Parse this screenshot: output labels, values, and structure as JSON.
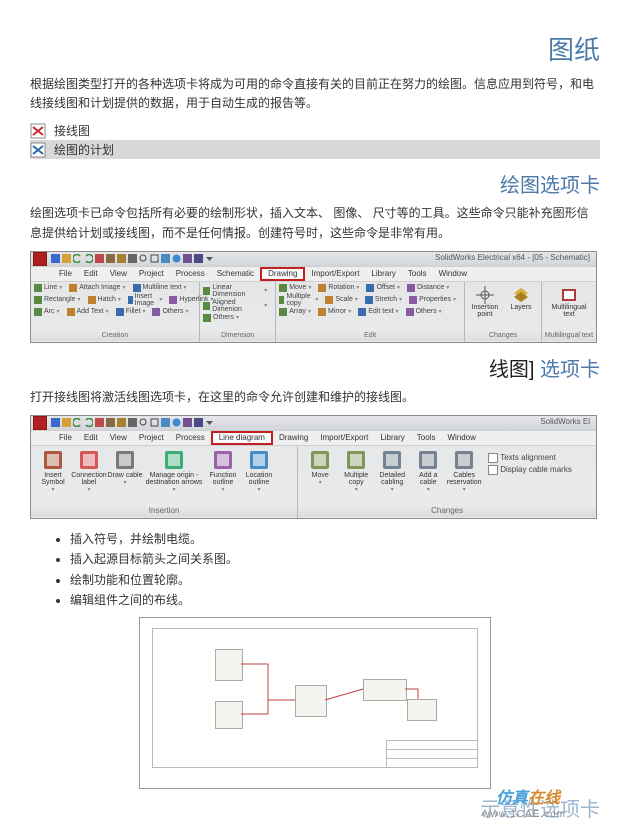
{
  "title_main": "图纸",
  "intro_text": "根据绘图类型打开的各种选项卡将成为可用的命令直接有关的目前正在努力的绘图。信息应用到符号，和电线接线图和计划提供的数据，用于自动生成的报告等。",
  "link_items": [
    {
      "label": "接线图",
      "icon_color": "#c03030"
    },
    {
      "label": "绘图的计划",
      "icon_color": "#2a6aa8",
      "selected": true
    }
  ],
  "section1_title": "绘图选项卡",
  "section1_text": "绘图选项卡已命令包括所有必要的绘制形状，插入文本、 图像、 尺寸等的工具。这些命令只能补充图形信息提供给计划或接线图，而不是任何情报。创建符号时，这些命令是非常有用。",
  "ribbon1": {
    "window_title": "SolidWorks Electrical x64 - [05 - Schematic]",
    "tabs": [
      "File",
      "Edit",
      "View",
      "Project",
      "Process",
      "Schematic",
      "Drawing",
      "Import/Export",
      "Library",
      "Tools",
      "Window"
    ],
    "active_tab": "Drawing",
    "group_creation": {
      "name": "Creation",
      "row1": [
        "Line",
        "Attach Image",
        "Multiline text"
      ],
      "row2": [
        "Rectangle",
        "Hatch",
        "Insert Image",
        "Hyperlink"
      ],
      "row3": [
        "Arc",
        "Add Text",
        "Fillet",
        "Others"
      ]
    },
    "group_dimension": {
      "name": "Dimension",
      "row1": [
        "Linear Dimension"
      ],
      "row2": [
        "Aligned Dimenion"
      ],
      "row3": [
        "Others"
      ]
    },
    "group_edit": {
      "name": "Edit",
      "row1": [
        "Move",
        "Rotation",
        "Offset",
        "Distance"
      ],
      "row2": [
        "Multiple copy",
        "Scale",
        "Stretch",
        "Properties"
      ],
      "row3": [
        "Array",
        "Mirror",
        "Edit text",
        "Others"
      ]
    },
    "group_changes": {
      "name": "Changes",
      "btn1": "Insertion point",
      "btn2": "Layers"
    },
    "group_multi": {
      "name": "Multilingual text",
      "btn": "Multilingual text"
    }
  },
  "section2_title_a": "线图]",
  "section2_title_b": " 选项卡",
  "section2_text": "打开接线图将激活线图选项卡，在这里的命令允许创建和维护的接线图。",
  "ribbon2": {
    "window_title": "SolidWorks El",
    "tabs": [
      "File",
      "Edit",
      "View",
      "Project",
      "Process",
      "Line diagram",
      "Drawing",
      "Import/Export",
      "Library",
      "Tools",
      "Window"
    ],
    "active_tab": "Line diagram",
    "group_insertion": {
      "name": "Insertion",
      "btns": [
        {
          "label": "Insert Symbol",
          "color": "#a04020"
        },
        {
          "label": "Connection label",
          "color": "#d04040"
        },
        {
          "label": "Draw cable",
          "color": "#666666"
        },
        {
          "label": "Manage origin - destination arrows",
          "color": "#20a060",
          "wide": true
        },
        {
          "label": "Function outline",
          "color": "#8a4b9b"
        },
        {
          "label": "Location outline",
          "color": "#2a7bc0"
        }
      ]
    },
    "group_changes": {
      "name": "Changes",
      "btns": [
        {
          "label": "Move",
          "color": "#6a8a40"
        },
        {
          "label": "Multiple copy",
          "color": "#6a8a40"
        },
        {
          "label": "Detailed cabling",
          "color": "#607080"
        },
        {
          "label": "Add a cable",
          "color": "#607080"
        },
        {
          "label": "Cables reservation",
          "color": "#607080"
        }
      ],
      "checks": [
        "Texts alignment",
        "Display cable marks"
      ]
    }
  },
  "bullets": [
    "插入符号，并绘制电缆。",
    "插入起源目标箭头之间关系图。",
    "绘制功能和位置轮廓。",
    "编辑组件之间的布线。"
  ],
  "bottom_title": "示意性选项卡",
  "watermark_a": "仿真",
  "watermark_b": "在线",
  "url": "www.1CAE.com"
}
